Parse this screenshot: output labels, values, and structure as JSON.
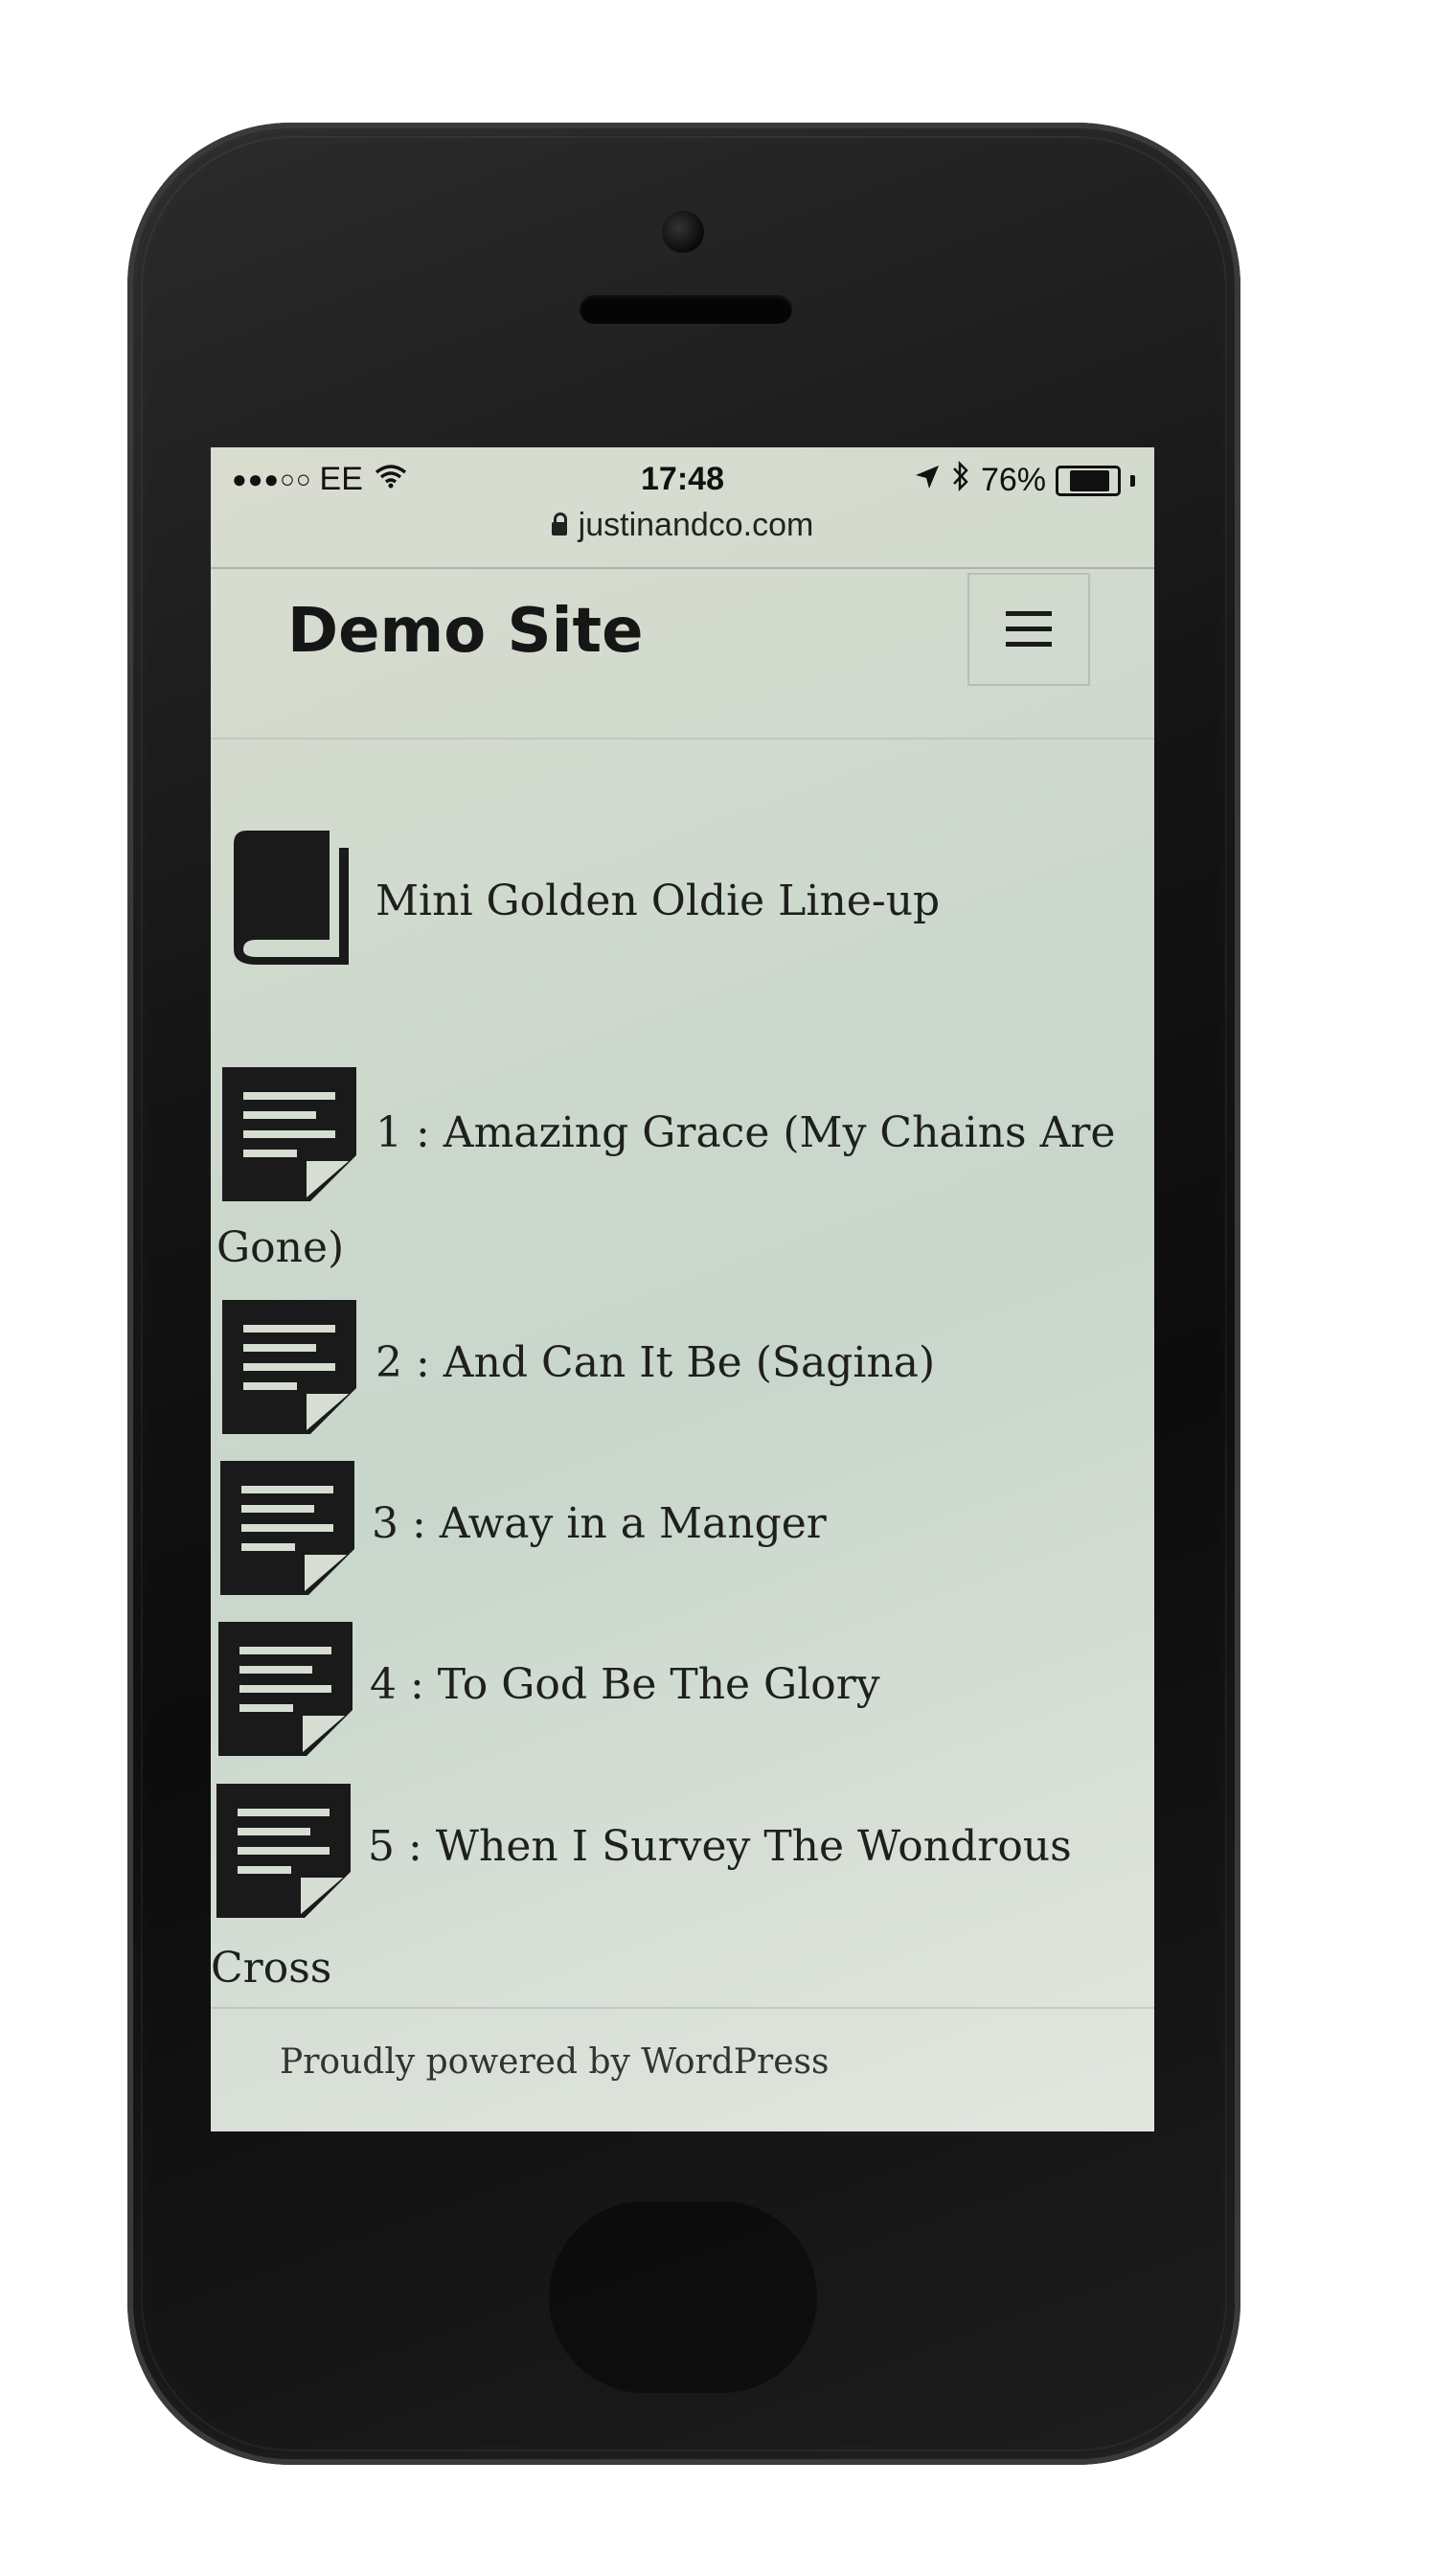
{
  "status_bar": {
    "signal": "●●●○○",
    "carrier": "EE",
    "wifi_icon": "wifi-icon",
    "time": "17:48",
    "location_icon": "location-arrow-icon",
    "bluetooth_icon": "bluetooth-icon",
    "battery_percent": "76%",
    "battery_level": 0.76
  },
  "browser": {
    "url": "justinandco.com"
  },
  "header": {
    "site_title": "Demo Site",
    "menu_icon": "hamburger-menu-icon"
  },
  "content": {
    "book": {
      "icon": "book-icon",
      "title": "Mini Golden Oldie Line-up"
    },
    "items": [
      {
        "icon": "document-icon",
        "line1": "1 : Amazing Grace (My Chains Are",
        "line2": "Gone)"
      },
      {
        "icon": "document-icon",
        "line1": "2 : And Can It Be (Sagina)"
      },
      {
        "icon": "document-icon",
        "line1": "3 : Away in a Manger"
      },
      {
        "icon": "document-icon",
        "line1": "4 : To God Be The Glory"
      },
      {
        "icon": "document-icon",
        "line1": "5 : When I Survey The Wondrous",
        "line2": "Cross"
      }
    ]
  },
  "footer": {
    "credit": "Proudly powered by WordPress"
  },
  "colors": {
    "screen_tint": "#cfd9cd",
    "text": "#1c1c1c",
    "phone_body": "#151515"
  }
}
